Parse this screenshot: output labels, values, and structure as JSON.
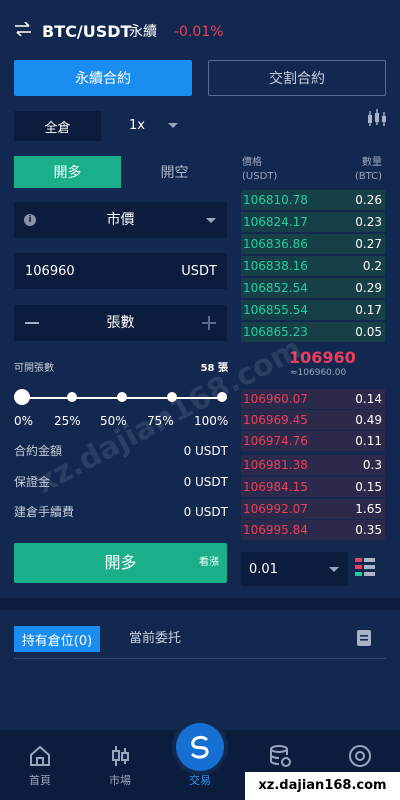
{
  "header": {
    "pair": "BTC/USDT",
    "kind": "永續",
    "change": "-0.01%",
    "change_color": "#ee3d5c"
  },
  "contract_tabs": {
    "perpetual": "永續合約",
    "delivery": "交割合約"
  },
  "margin": {
    "mode": "全倉",
    "leverage": "1x"
  },
  "side_tabs": {
    "long": "開多",
    "short": "開空"
  },
  "order_type": {
    "value": "市價",
    "info_glyph": "i"
  },
  "price_field": {
    "value": "106960",
    "unit": "USDT"
  },
  "qty_field": {
    "label": "張數"
  },
  "available": {
    "label": "可開張數",
    "value": "58 張"
  },
  "slider": {
    "marks": [
      "0%",
      "25%",
      "50%",
      "75%",
      "100%"
    ],
    "value_percent": 0
  },
  "info_rows": [
    {
      "label": "合約金額",
      "value": "0 USDT"
    },
    {
      "label": "保證金",
      "value": "0 USDT"
    },
    {
      "label": "建倉手續費",
      "value": "0 USDT"
    }
  ],
  "open_button": {
    "label": "開多",
    "sub": "看漲"
  },
  "orderbook": {
    "price_header": "價格",
    "price_unit": "(USDT)",
    "qty_header": "數量",
    "qty_unit": "(BTC)",
    "bids": [
      {
        "price": "106810.78",
        "qty": "0.26"
      },
      {
        "price": "106824.17",
        "qty": "0.23"
      },
      {
        "price": "106836.86",
        "qty": "0.27"
      },
      {
        "price": "106838.16",
        "qty": "0.2"
      },
      {
        "price": "106852.54",
        "qty": "0.29"
      },
      {
        "price": "106855.54",
        "qty": "0.17"
      },
      {
        "price": "106865.23",
        "qty": "0.05"
      }
    ],
    "mid_price": "106960",
    "mid_sub": "≈106960.00",
    "asks": [
      {
        "price": "106960.07",
        "qty": "0.14"
      },
      {
        "price": "106969.45",
        "qty": "0.49"
      },
      {
        "price": "106974.76",
        "qty": "0.11"
      },
      {
        "price": "106981.38",
        "qty": "0.3"
      },
      {
        "price": "106984.15",
        "qty": "0.15"
      },
      {
        "price": "106992.07",
        "qty": "1.65"
      },
      {
        "price": "106995.84",
        "qty": "0.35"
      }
    ],
    "depth": "0.01"
  },
  "positions": {
    "tab_positions": "持有倉位(0)",
    "tab_orders": "當前委托"
  },
  "nav": [
    {
      "label": "首頁",
      "icon": "home-icon"
    },
    {
      "label": "市場",
      "icon": "candlestick-icon"
    },
    {
      "label": "交易",
      "icon": "trade-icon"
    },
    {
      "label": "",
      "icon": "database-icon"
    },
    {
      "label": "",
      "icon": "profile-icon"
    }
  ],
  "watermark": {
    "diagonal": "xz.dajian168.com",
    "corner": "xz.dajian168.com"
  },
  "colors": {
    "background": "#13284f",
    "panel": "#0c1c3c",
    "accent_blue": "#1a8ef0",
    "long_green": "#1aaf8a",
    "bid_green": "#1fcf9c",
    "ask_red": "#ee3d5c"
  }
}
